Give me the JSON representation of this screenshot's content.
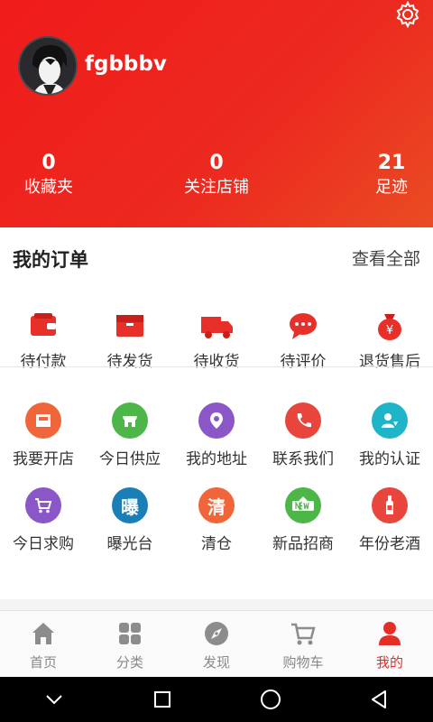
{
  "profile": {
    "username": "fgbbbv",
    "avatar_icon": "user-avatar-portrait"
  },
  "stats": [
    {
      "value": "0",
      "label": "收藏夹"
    },
    {
      "value": "0",
      "label": "关注店铺"
    },
    {
      "value": "21",
      "label": "足迹"
    }
  ],
  "orders": {
    "title": "我的订单",
    "view_all": "查看全部",
    "items": [
      {
        "label": "待付款",
        "icon": "wallet-icon"
      },
      {
        "label": "待发货",
        "icon": "box-icon"
      },
      {
        "label": "待收货",
        "icon": "truck-icon"
      },
      {
        "label": "待评价",
        "icon": "chat-bubble-icon"
      },
      {
        "label": "退货售后",
        "icon": "money-bag-icon"
      }
    ]
  },
  "services": {
    "row1": [
      {
        "label": "我要开店",
        "icon": "shop-icon",
        "color": "#f0663a"
      },
      {
        "label": "今日供应",
        "icon": "store-icon",
        "color": "#4cb748"
      },
      {
        "label": "我的地址",
        "icon": "location-icon",
        "color": "#8a56c8"
      },
      {
        "label": "联系我们",
        "icon": "phone-icon",
        "color": "#e8453c"
      },
      {
        "label": "我的认证",
        "icon": "verified-user-icon",
        "color": "#1fb5c9"
      }
    ],
    "row2": [
      {
        "label": "今日求购",
        "icon": "cart-icon",
        "color": "#8a56c8"
      },
      {
        "label": "曝光台",
        "icon": "exposure-icon",
        "glyph": "曝",
        "color": "#1b7fb7"
      },
      {
        "label": "清仓",
        "icon": "clearance-icon",
        "glyph": "清",
        "color": "#f0663a"
      },
      {
        "label": "新品招商",
        "icon": "new-badge-icon",
        "color": "#4cb748"
      },
      {
        "label": "年份老酒",
        "icon": "wine-bottle-icon",
        "color": "#e8453c"
      }
    ]
  },
  "tabs": [
    {
      "label": "首页",
      "icon": "home-icon"
    },
    {
      "label": "分类",
      "icon": "category-grid-icon"
    },
    {
      "label": "发现",
      "icon": "compass-icon"
    },
    {
      "label": "购物车",
      "icon": "cart-icon"
    },
    {
      "label": "我的",
      "icon": "person-icon",
      "active": true
    }
  ],
  "colors": {
    "brand": "#e52d27",
    "tab_inactive": "#888888"
  }
}
